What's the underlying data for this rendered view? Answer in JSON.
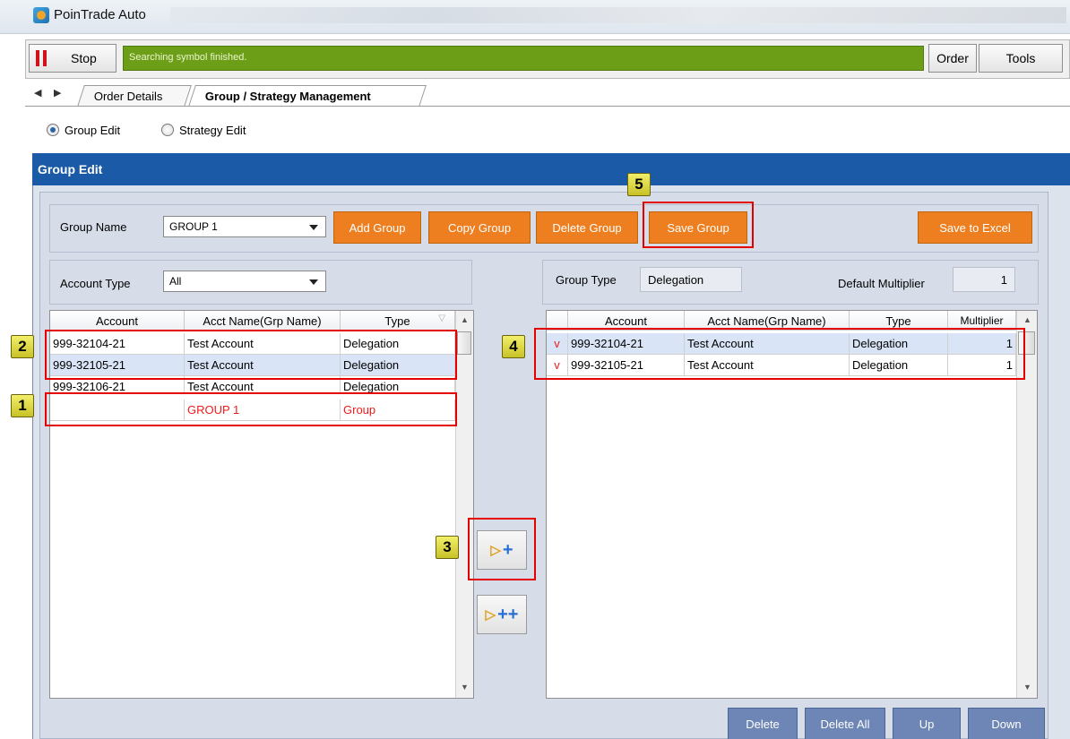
{
  "app": {
    "title": "PoinTrade Auto"
  },
  "toolbar": {
    "stop_label": "Stop",
    "status_text": "Searching symbol finished.",
    "order_label": "Order",
    "tools_label": "Tools"
  },
  "tabs": [
    {
      "label": "Order Details",
      "active": false
    },
    {
      "label": "Group / Strategy Management",
      "active": true
    }
  ],
  "mode": {
    "group_edit_label": "Group Edit",
    "strategy_edit_label": "Strategy Edit",
    "selected": "Group Edit"
  },
  "panel": {
    "header": "Group Edit"
  },
  "group": {
    "name_label": "Group Name",
    "name_value": "GROUP 1",
    "add_label": "Add Group",
    "copy_label": "Copy Group",
    "delete_label": "Delete Group",
    "save_label": "Save Group",
    "excel_label": "Save to Excel"
  },
  "filters": {
    "account_type_label": "Account Type",
    "account_type_value": "All"
  },
  "group_info": {
    "type_label": "Group Type",
    "type_value": "Delegation",
    "multiplier_label": "Default Multiplier",
    "multiplier_value": "1"
  },
  "left_table": {
    "columns": [
      "Account",
      "Acct Name(Grp Name)",
      "Type"
    ],
    "rows": [
      {
        "account": "999-32104-21",
        "name": "Test Account",
        "type": "Delegation"
      },
      {
        "account": "999-32105-21",
        "name": "Test Account",
        "type": "Delegation"
      },
      {
        "account": "999-32106-21",
        "name": "Test Account",
        "type": "Delegation"
      },
      {
        "account": "",
        "name": "GROUP 1",
        "type": "Group"
      }
    ]
  },
  "right_table": {
    "columns": [
      "Account",
      "Acct Name(Grp Name)",
      "Type",
      "Multiplier"
    ],
    "rows": [
      {
        "check": "v",
        "account": "999-32104-21",
        "name": "Test Account",
        "type": "Delegation",
        "multiplier": "1"
      },
      {
        "check": "v",
        "account": "999-32105-21",
        "name": "Test Account",
        "type": "Delegation",
        "multiplier": "1"
      }
    ]
  },
  "bottom_buttons": {
    "delete": "Delete",
    "delete_all": "Delete All",
    "up": "Up",
    "down": "Down"
  },
  "annotations": {
    "one": "1",
    "two": "2",
    "three": "3",
    "four": "4",
    "five": "5"
  },
  "colors": {
    "status_green": "#6d9e17",
    "header_blue": "#1a5aa6",
    "orange": "#ee7f20",
    "annotation_red": "#e50000"
  }
}
